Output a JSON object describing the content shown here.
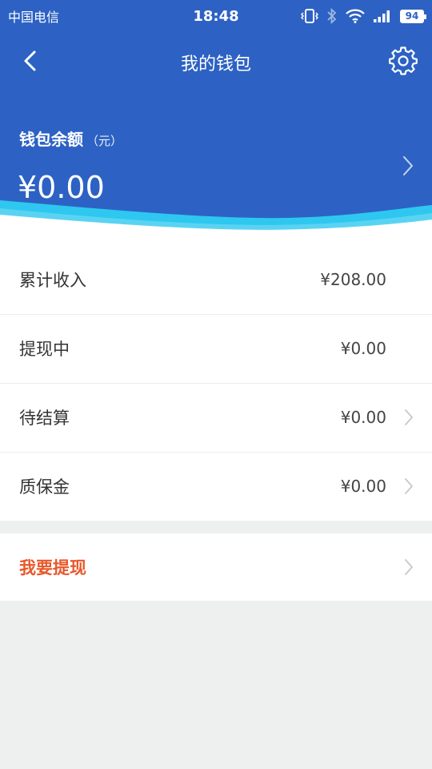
{
  "status_bar": {
    "carrier": "中国电信",
    "time": "18:48",
    "battery": "94"
  },
  "header": {
    "title": "我的钱包",
    "balance_label": "钱包余额",
    "balance_unit": "（元）",
    "balance_amount": "¥0.00"
  },
  "rows": [
    {
      "label": "累计收入",
      "value": "¥208.00",
      "has_chevron": false
    },
    {
      "label": "提现中",
      "value": "¥0.00",
      "has_chevron": false
    },
    {
      "label": "待结算",
      "value": "¥0.00",
      "has_chevron": true
    },
    {
      "label": "质保金",
      "value": "¥0.00",
      "has_chevron": true
    }
  ],
  "withdraw": {
    "label": "我要提现"
  },
  "colors": {
    "primary": "#2d62c4",
    "accent": "#e8582b",
    "wave": "#2ec7f0",
    "background": "#eef0f0"
  },
  "icons": {
    "back": "back-icon",
    "settings": "gear-icon",
    "chevron": "chevron-right-icon"
  }
}
